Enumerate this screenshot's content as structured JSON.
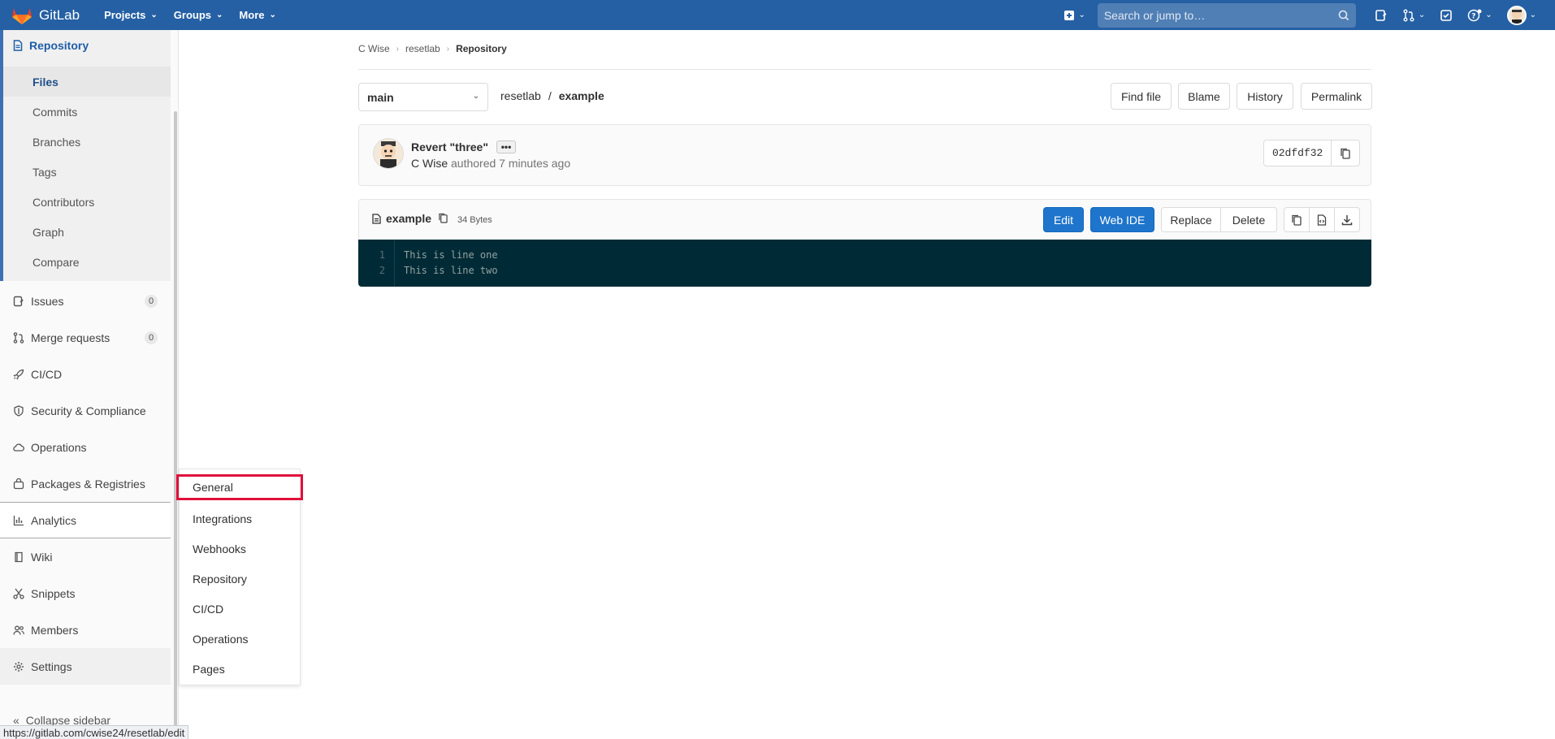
{
  "navbar": {
    "brand": "GitLab",
    "menus": [
      {
        "label": "Projects"
      },
      {
        "label": "Groups"
      },
      {
        "label": "More"
      }
    ],
    "search_placeholder": "Search or jump to…",
    "icons": [
      "plus-square-icon",
      "search-icon",
      "issues-icon",
      "merge-request-icon",
      "todo-icon",
      "help-icon",
      "user-avatar"
    ]
  },
  "sidebar": {
    "section": "Repository",
    "sub_items": [
      "Files",
      "Commits",
      "Branches",
      "Tags",
      "Contributors",
      "Graph",
      "Compare"
    ],
    "active_sub": "Files",
    "items": [
      {
        "label": "Issues",
        "badge": "0",
        "icon": "issues-icon"
      },
      {
        "label": "Merge requests",
        "badge": "0",
        "icon": "merge-request-icon"
      },
      {
        "label": "CI/CD",
        "icon": "rocket-icon"
      },
      {
        "label": "Security & Compliance",
        "icon": "shield-icon"
      },
      {
        "label": "Operations",
        "icon": "cloud-icon"
      },
      {
        "label": "Packages & Registries",
        "icon": "package-icon"
      },
      {
        "label": "Analytics",
        "icon": "chart-icon"
      },
      {
        "label": "Wiki",
        "icon": "book-icon"
      },
      {
        "label": "Snippets",
        "icon": "scissors-icon"
      },
      {
        "label": "Members",
        "icon": "users-icon"
      },
      {
        "label": "Settings",
        "icon": "gear-icon"
      }
    ],
    "collapse_label": "Collapse sidebar"
  },
  "settings_flyout": {
    "items": [
      "General",
      "Integrations",
      "Webhooks",
      "Repository",
      "CI/CD",
      "Operations",
      "Pages"
    ],
    "highlighted": "General"
  },
  "breadcrumb": [
    "C Wise",
    "resetlab",
    "Repository"
  ],
  "tree": {
    "branch": "main",
    "project": "resetlab",
    "file": "example",
    "separator": "/",
    "buttons": [
      "Find file",
      "Blame",
      "History",
      "Permalink"
    ]
  },
  "commit": {
    "title": "Revert \"three\"",
    "dots": "•••",
    "author": "C Wise",
    "meta": "authored 7 minutes ago",
    "sha": "02dfdf32"
  },
  "file": {
    "name": "example",
    "size": "34 Bytes",
    "buttons": {
      "edit": "Edit",
      "web_ide": "Web IDE",
      "replace": "Replace",
      "delete": "Delete"
    },
    "lines": [
      {
        "n": "1",
        "text": "This is line one"
      },
      {
        "n": "2",
        "text": "This is line two"
      }
    ]
  },
  "status_url": "https://gitlab.com/cwise24/resetlab/edit",
  "colors": {
    "navbar": "#2560a4",
    "primary": "#1f75cb",
    "highlight_outline": "#e0103c",
    "code_bg": "#002b36"
  }
}
